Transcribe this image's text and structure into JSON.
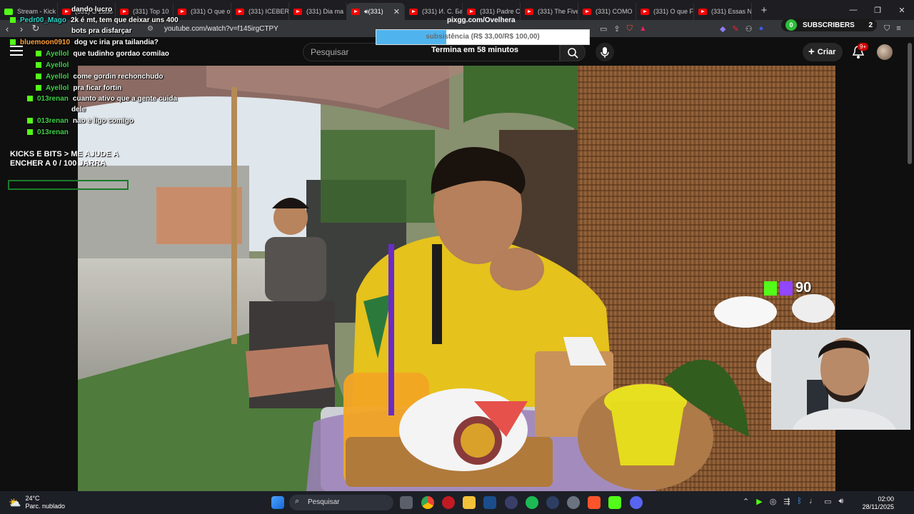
{
  "browser": {
    "tabs": [
      {
        "label": "Stream - Kick",
        "kind": "kick"
      },
      {
        "label": "(331) O Lado",
        "kind": "yt"
      },
      {
        "label": "(331) Top 10",
        "kind": "yt"
      },
      {
        "label": "(331) O que o",
        "kind": "yt"
      },
      {
        "label": "(331) ICEBERG",
        "kind": "yt"
      },
      {
        "label": "(331) Dia ma",
        "kind": "yt"
      },
      {
        "label": "(331)",
        "kind": "yt",
        "active": true
      },
      {
        "label": "(331) И. С. Ба",
        "kind": "yt"
      },
      {
        "label": "(331) Padre C",
        "kind": "yt"
      },
      {
        "label": "(331) The Five",
        "kind": "yt"
      },
      {
        "label": "(331) COMO",
        "kind": "yt"
      },
      {
        "label": "(331) O que F",
        "kind": "yt"
      },
      {
        "label": "(331) Essas N",
        "kind": "yt"
      }
    ],
    "url": "youtube.com/watch?v=f145irgCTPY"
  },
  "overlay": {
    "subscribers_label": "SUBSCRIBERS",
    "subscribers_count": "2",
    "subscribers_badge": "0",
    "pix_title": "pixgg.com/Ovelhera",
    "pix_goal_text": "subsistência (R$ 33,00/R$ 100,00)",
    "pix_progress": 0.33,
    "countdown": "Termina em 58 minutos",
    "kick_count": "90",
    "goal_title": "KICKS E BITS > ME AJUDE A ENCHER A  0 / 100 JARRA",
    "goal_progress": 0
  },
  "chat": [
    {
      "user": "",
      "text": "dando lucro",
      "color": "green"
    },
    {
      "user": "Pedr00_Mago",
      "text": "2k é mt, tem que deixar uns 400",
      "color": "cyan"
    },
    {
      "user": "",
      "text": "bots pra disfarçar",
      "color": "green"
    },
    {
      "user": "bluemoon0910",
      "text": "dog vc iria pra tailandia?",
      "color": "orange"
    },
    {
      "user": "Ayellol",
      "text": "que tudinho gordao comilao",
      "color": "green"
    },
    {
      "user": "Ayellol",
      "text": "",
      "color": "green"
    },
    {
      "user": "Ayellol",
      "text": "come gordin rechonchudo",
      "color": "green"
    },
    {
      "user": "Ayellol",
      "text": "pra ficar fortin",
      "color": "green"
    },
    {
      "user": "013renan",
      "text": "cuanto ativo que a gente cuida",
      "color": "green"
    },
    {
      "user": "",
      "text": "dele",
      "color": "green"
    },
    {
      "user": "013renan",
      "text": "nao e ligo comigo",
      "color": "green"
    },
    {
      "user": "013renan",
      "text": "",
      "color": "green"
    }
  ],
  "youtube": {
    "search_placeholder": "Pesquisar",
    "create_label": "Criar",
    "notif_count": "9+"
  },
  "taskbar": {
    "temp": "24°C",
    "weather": "Parc. nublado",
    "search": "Pesquisar",
    "time": "02:00",
    "date": "28/11/2025"
  }
}
